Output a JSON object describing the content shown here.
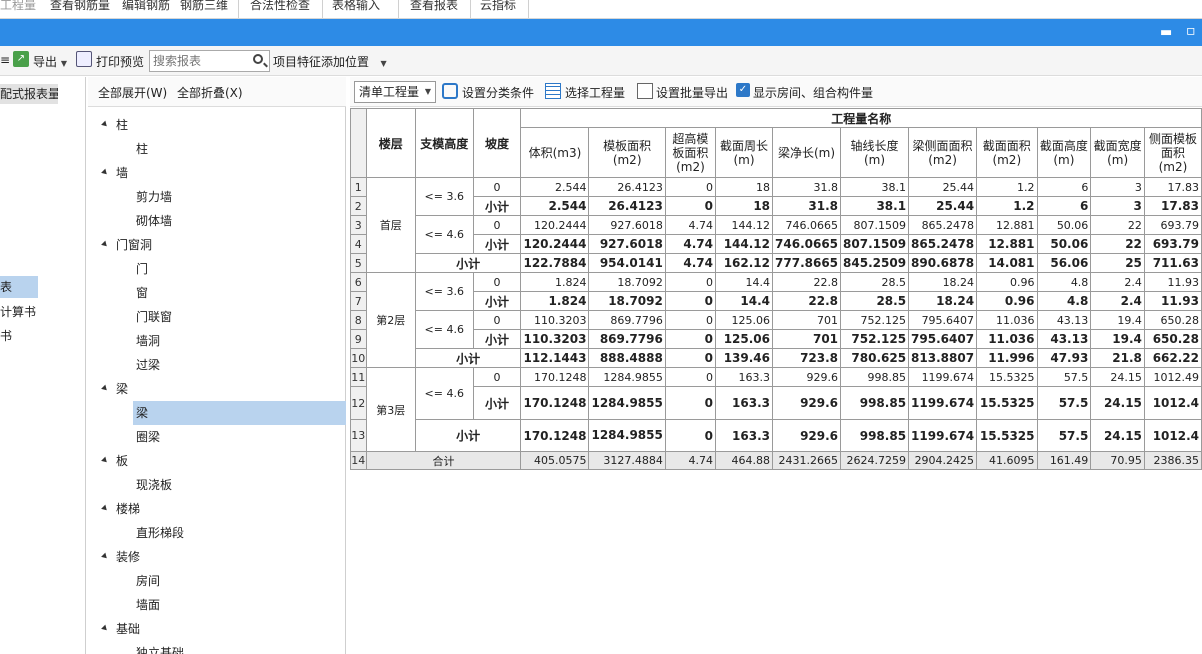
{
  "ribbon": {
    "tabs": [
      "工程量",
      "查看钢筋量",
      "编辑钢筋",
      "钢筋三维",
      "合法性检查",
      "表格输入",
      "查看报表",
      "云指标"
    ]
  },
  "toolbar1": {
    "export_label": "导出",
    "print_label": "打印预览",
    "search_placeholder": "搜索报表",
    "feature_label": "项目特征添加位置"
  },
  "leftpane": {
    "tab_label": "配式报表量",
    "items": [
      "表",
      "计算书",
      "书"
    ]
  },
  "tree": {
    "expand_all": "全部展开(W)",
    "collapse_all": "全部折叠(X)",
    "nodes": [
      {
        "label": "柱",
        "level": 0
      },
      {
        "label": "柱",
        "level": 1
      },
      {
        "label": "墙",
        "level": 0
      },
      {
        "label": "剪力墙",
        "level": 1
      },
      {
        "label": "砌体墙",
        "level": 1
      },
      {
        "label": "门窗洞",
        "level": 0
      },
      {
        "label": "门",
        "level": 1
      },
      {
        "label": "窗",
        "level": 1
      },
      {
        "label": "门联窗",
        "level": 1
      },
      {
        "label": "墙洞",
        "level": 1
      },
      {
        "label": "过梁",
        "level": 1
      },
      {
        "label": "梁",
        "level": 0
      },
      {
        "label": "梁",
        "level": 1
      },
      {
        "label": "圈梁",
        "level": 1
      },
      {
        "label": "板",
        "level": 0
      },
      {
        "label": "现浇板",
        "level": 1
      },
      {
        "label": "楼梯",
        "level": 0
      },
      {
        "label": "直形梯段",
        "level": 1
      },
      {
        "label": "装修",
        "level": 0
      },
      {
        "label": "房间",
        "level": 1
      },
      {
        "label": "墙面",
        "level": 1
      },
      {
        "label": "基础",
        "level": 0
      },
      {
        "label": "独立基础",
        "level": 1
      }
    ]
  },
  "maintb": {
    "combo_value": "清单工程量",
    "classify_label": "设置分类条件",
    "select_label": "选择工程量",
    "batch_export_label": "设置批量导出",
    "show_room_label": "显示房间、组合构件量"
  },
  "grid": {
    "group_header": "工程量名称",
    "fixed_headers": [
      "楼层",
      "支模高度",
      "坡度"
    ],
    "col_headers": [
      "体积(m3)",
      "模板面积(m2)",
      "超高模板面积(m2)",
      "截面周长(m)",
      "梁净长(m)",
      "轴线长度(m)",
      "梁侧面面积(m2)",
      "截面面积(m2)",
      "截面高度(m)",
      "截面宽度(m)",
      "侧面模板面积(m2)"
    ],
    "floors": [
      "首层",
      "第2层",
      "第3层"
    ],
    "heights": [
      "<= 3.6",
      "<= 4.6"
    ],
    "slope": "0",
    "subtotal": "小计",
    "total": "合计",
    "rows": [
      [
        "2.544",
        "26.4123",
        "0",
        "18",
        "31.8",
        "38.1",
        "25.44",
        "1.2",
        "6",
        "3",
        "17.83"
      ],
      [
        "2.544",
        "26.4123",
        "0",
        "18",
        "31.8",
        "38.1",
        "25.44",
        "1.2",
        "6",
        "3",
        "17.83"
      ],
      [
        "120.2444",
        "927.6018",
        "4.74",
        "144.12",
        "746.0665",
        "807.1509",
        "865.2478",
        "12.881",
        "50.06",
        "22",
        "693.79"
      ],
      [
        "120.2444",
        "927.6018",
        "4.74",
        "144.12",
        "746.0665",
        "807.1509",
        "865.2478",
        "12.881",
        "50.06",
        "22",
        "693.79"
      ],
      [
        "122.7884",
        "954.0141",
        "4.74",
        "162.12",
        "777.8665",
        "845.2509",
        "890.6878",
        "14.081",
        "56.06",
        "25",
        "711.63"
      ],
      [
        "1.824",
        "18.7092",
        "0",
        "14.4",
        "22.8",
        "28.5",
        "18.24",
        "0.96",
        "4.8",
        "2.4",
        "11.93"
      ],
      [
        "1.824",
        "18.7092",
        "0",
        "14.4",
        "22.8",
        "28.5",
        "18.24",
        "0.96",
        "4.8",
        "2.4",
        "11.93"
      ],
      [
        "110.3203",
        "869.7796",
        "0",
        "125.06",
        "701",
        "752.125",
        "795.6407",
        "11.036",
        "43.13",
        "19.4",
        "650.28"
      ],
      [
        "110.3203",
        "869.7796",
        "0",
        "125.06",
        "701",
        "752.125",
        "795.6407",
        "11.036",
        "43.13",
        "19.4",
        "650.28"
      ],
      [
        "112.1443",
        "888.4888",
        "0",
        "139.46",
        "723.8",
        "780.625",
        "813.8807",
        "11.996",
        "47.93",
        "21.8",
        "662.22"
      ],
      [
        "170.1248",
        "1284.9855",
        "0",
        "163.3",
        "929.6",
        "998.85",
        "1199.674",
        "15.5325",
        "57.5",
        "24.15",
        "1012.49"
      ],
      [
        "170.1248",
        "1284.9855",
        "0",
        "163.3",
        "929.6",
        "998.85",
        "1199.674",
        "15.5325",
        "57.5",
        "24.15",
        "1012.4"
      ],
      [
        "170.1248",
        "1284.9855",
        "0",
        "163.3",
        "929.6",
        "998.85",
        "1199.674",
        "15.5325",
        "57.5",
        "24.15",
        "1012.4"
      ],
      [
        "405.0575",
        "3127.4884",
        "4.74",
        "464.88",
        "2431.2665",
        "2624.7259",
        "2904.2425",
        "41.6095",
        "161.49",
        "70.95",
        "2386.35"
      ]
    ]
  }
}
